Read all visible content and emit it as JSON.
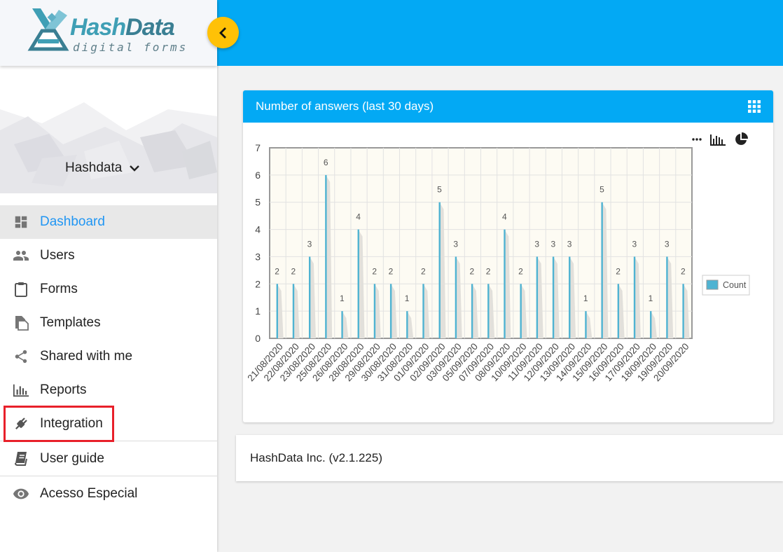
{
  "logo": {
    "brand": "HashData",
    "brand_part1": "Hash",
    "brand_part2": "Data",
    "tagline": "digital forms"
  },
  "user": {
    "name": "Hashdata"
  },
  "nav": [
    {
      "label": "Dashboard",
      "icon": "dashboard-icon",
      "active": true
    },
    {
      "label": "Users",
      "icon": "users-icon"
    },
    {
      "label": "Forms",
      "icon": "clipboard-icon"
    },
    {
      "label": "Templates",
      "icon": "templates-icon"
    },
    {
      "label": "Shared with me",
      "icon": "share-icon"
    },
    {
      "label": "Reports",
      "icon": "bar-chart-icon"
    },
    {
      "label": "Integration",
      "icon": "plug-icon",
      "highlighted": true
    },
    {
      "label": "User guide",
      "icon": "book-icon"
    },
    {
      "label": "Acesso Especial",
      "icon": "eye-icon"
    }
  ],
  "card": {
    "title": "Number of answers (last 30 days)"
  },
  "footer": {
    "text": "HashData Inc. (v2.1.225)"
  },
  "colors": {
    "topbar": "#03a9f4",
    "accent": "#2196f3",
    "toggle": "#ffc107",
    "bar": "#4fb3d2",
    "highlight": "#e8202a"
  },
  "chart_data": {
    "type": "bar",
    "categories": [
      "21/08/2020",
      "22/08/2020",
      "23/08/2020",
      "25/08/2020",
      "26/08/2020",
      "28/08/2020",
      "29/08/2020",
      "30/08/2020",
      "31/08/2020",
      "01/09/2020",
      "02/09/2020",
      "03/09/2020",
      "05/09/2020",
      "07/09/2020",
      "08/09/2020",
      "10/09/2020",
      "11/09/2020",
      "12/09/2020",
      "13/09/2020",
      "14/09/2020",
      "15/09/2020",
      "16/09/2020",
      "17/09/2020",
      "18/09/2020",
      "19/09/2020",
      "20/09/2020"
    ],
    "series": [
      {
        "name": "Count",
        "values": [
          2,
          2,
          3,
          6,
          1,
          4,
          2,
          2,
          1,
          2,
          5,
          3,
          2,
          2,
          4,
          2,
          3,
          3,
          3,
          1,
          5,
          2,
          3,
          1,
          3,
          2
        ]
      }
    ],
    "ylim": [
      0,
      7
    ],
    "yticks": [
      "0",
      "1",
      "2",
      "3",
      "4",
      "5",
      "6",
      "7"
    ],
    "grid": true,
    "legend": "right"
  }
}
